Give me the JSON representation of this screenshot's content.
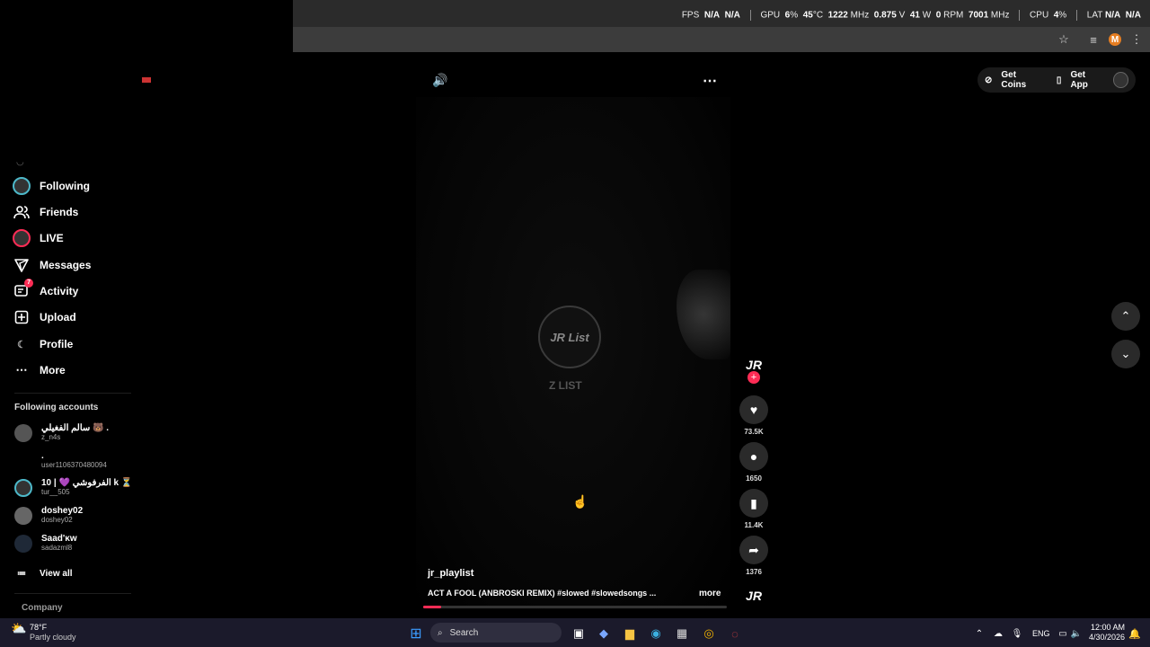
{
  "perf": {
    "fps_label": "FPS",
    "fps_val1": "N/A",
    "fps_val2": "N/A",
    "gpu_label": "GPU",
    "gpu_pct": "6",
    "gpu_pct_unit": "%",
    "gpu_temp": "45",
    "gpu_temp_unit": "°C",
    "gpu_clock": "1222",
    "gpu_clock_unit": "MHz",
    "gpu_volt": "0.875",
    "gpu_volt_unit": "V",
    "gpu_watt": "41",
    "gpu_watt_unit": "W",
    "gpu_rpm": "0",
    "gpu_rpm_unit": "RPM",
    "gpu_mem": "7001",
    "gpu_mem_unit": "MHz",
    "cpu_label": "CPU",
    "cpu_pct": "4",
    "cpu_pct_unit": "%",
    "lat_label": "LAT",
    "lat_val1": "N/A",
    "lat_val2": "N/A"
  },
  "browser": {
    "profile_initial": "M"
  },
  "sidebar": {
    "items": [
      {
        "label": "Following",
        "icon": "following-avatar"
      },
      {
        "label": "Friends",
        "icon": "friends-icon"
      },
      {
        "label": "LIVE",
        "icon": "live-avatar"
      },
      {
        "label": "Messages",
        "icon": "messages-icon"
      },
      {
        "label": "Activity",
        "icon": "activity-icon",
        "badge": "7"
      },
      {
        "label": "Upload",
        "icon": "upload-icon"
      },
      {
        "label": "Profile",
        "icon": "profile-icon"
      },
      {
        "label": "More",
        "icon": "more-icon"
      }
    ],
    "following_title": "Following accounts",
    "accounts": [
      {
        "name": "سالم الفغيلي 🐻 .",
        "id": "z_n4s"
      },
      {
        "name": ".",
        "id": "user1106370480094"
      },
      {
        "name": "10 | 💜 الفرفوشي k ⏳",
        "id": "tur__505"
      },
      {
        "name": "doshey02",
        "id": "doshey02"
      },
      {
        "name": "Saad'ᴋᴡ",
        "id": "sadazml8"
      }
    ],
    "view_all": "View all",
    "company": "Company"
  },
  "top_actions": {
    "get_coins": "Get Coins",
    "get_app": "Get App"
  },
  "video": {
    "logo_text": "JR List",
    "caption_text": "Z LIST",
    "author": "jr_playlist",
    "description": "ACT A FOOL (ANBROSKI REMIX) #slowed #slowedsongs ...",
    "more": "more",
    "progress": 0.06
  },
  "rail": {
    "likes": "73.5K",
    "comments": "1650",
    "saves": "11.4K",
    "shares": "1376",
    "follow_plus": "+"
  },
  "taskbar": {
    "weather_temp": "78°F",
    "weather_desc": "Partly cloudy",
    "search": "Search",
    "lang": "ENG",
    "time": "12:00 AM",
    "date": "4/30/2026"
  }
}
